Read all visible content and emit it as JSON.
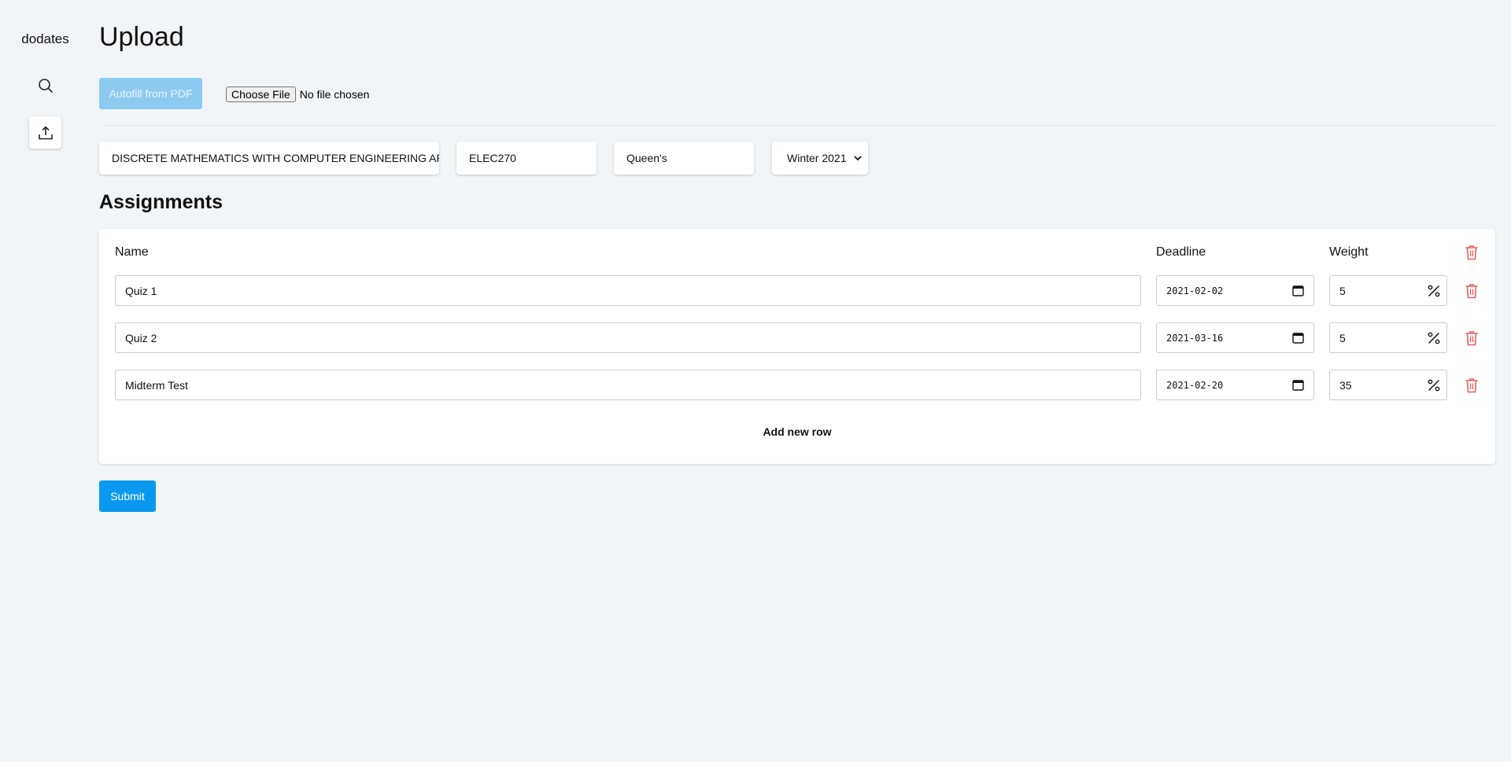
{
  "sidebar": {
    "brand": "dodates",
    "items": [
      {
        "icon": "search-icon"
      },
      {
        "icon": "upload-icon"
      }
    ]
  },
  "page": {
    "title": "Upload"
  },
  "autofill": {
    "label": "Autofill from PDF"
  },
  "file_input": {
    "button_label": "Choose File",
    "status": "No file chosen"
  },
  "course": {
    "name": "DISCRETE MATHEMATICS WITH COMPUTER ENGINEERING AF",
    "code": "ELEC270",
    "school": "Queen's",
    "term": "Winter 2021"
  },
  "assignments": {
    "title": "Assignments",
    "headers": {
      "name": "Name",
      "deadline": "Deadline",
      "weight": "Weight"
    },
    "rows": [
      {
        "name": "Quiz 1",
        "deadline": "2021-02-02",
        "weight": "5"
      },
      {
        "name": "Quiz 2",
        "deadline": "2021-03-16",
        "weight": "5"
      },
      {
        "name": "Midterm Test",
        "deadline": "2021-02-20",
        "weight": "35"
      }
    ],
    "add_row_label": "Add new row"
  },
  "submit": {
    "label": "Submit"
  },
  "colors": {
    "primary": "#0a99ef",
    "autofill_disabled": "#8ccaf2",
    "danger": "#e8615c",
    "background": "#f2f5f8"
  }
}
